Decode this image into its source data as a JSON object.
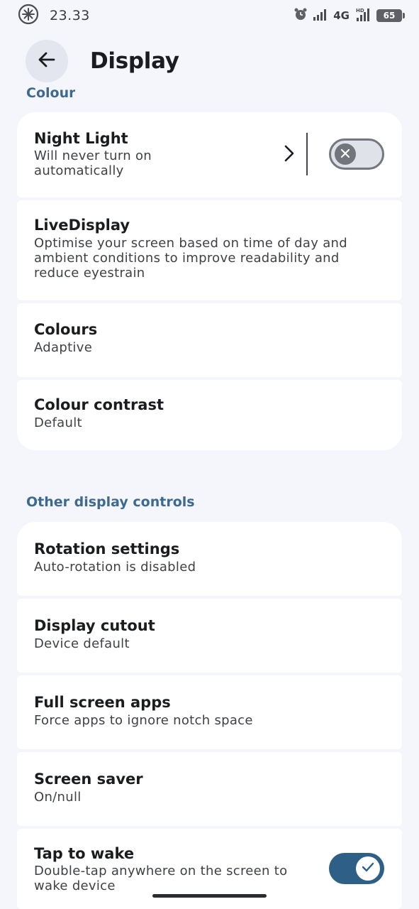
{
  "status_bar": {
    "time": "23.33",
    "network": "4G",
    "battery": "65"
  },
  "header": {
    "title": "Display",
    "back_icon": "arrow-back-icon"
  },
  "sections": {
    "colour": {
      "label": "Colour",
      "items": [
        {
          "title": "Night Light",
          "subtitle": "Will never turn on automatically",
          "toggle": false
        },
        {
          "title": "LiveDisplay",
          "subtitle": "Optimise your screen based on time of day and ambient conditions to improve readability and reduce eyestrain"
        },
        {
          "title": "Colours",
          "subtitle": "Adaptive"
        },
        {
          "title": "Colour contrast",
          "subtitle": "Default"
        }
      ]
    },
    "other": {
      "label": "Other display controls",
      "items": [
        {
          "title": "Rotation settings",
          "subtitle": "Auto-rotation is disabled"
        },
        {
          "title": "Display cutout",
          "subtitle": "Device default"
        },
        {
          "title": "Full screen apps",
          "subtitle": "Force apps to ignore notch space"
        },
        {
          "title": "Screen saver",
          "subtitle": "On/null"
        },
        {
          "title": "Tap to wake",
          "subtitle": "Double-tap anywhere on the screen to wake device",
          "toggle": true
        }
      ]
    }
  },
  "colors": {
    "accent": "#3d6a8e",
    "toggle_on": "#2e5f86",
    "background": "#f4f6fb",
    "card": "#ffffff"
  }
}
